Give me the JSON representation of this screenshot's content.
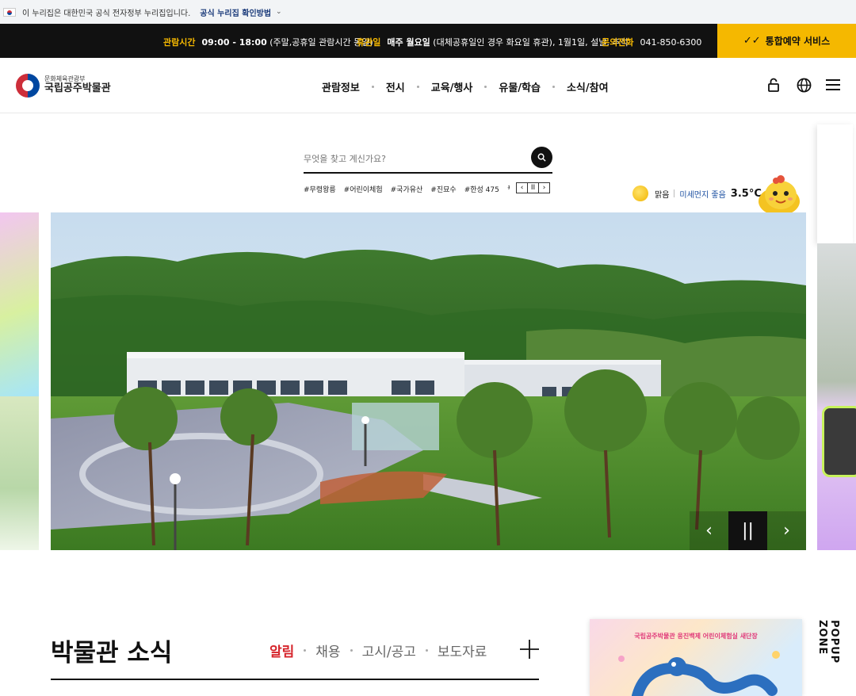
{
  "gov_banner": {
    "text": "이 누리집은 대한민국 공식 전자정부 누리집입니다.",
    "link": "공식 누리집 확인방법"
  },
  "info_bar": {
    "hours_label": "관람시간",
    "hours_value": "09:00 - 18:00",
    "hours_note": " (주말,공휴일 관람시간 동일)",
    "closed_label": "휴관일",
    "closed_value": "매주 월요일",
    "closed_note": " (대체공휴일인 경우 화요일 휴관), 1월1일, 설날, 추석",
    "phone_label": "문의전화",
    "phone_value": "041-850-6300",
    "reserve_label": "통합예약 서비스"
  },
  "header": {
    "logo_small": "문화체육관광부",
    "logo_big": "국립공주박물관",
    "nav": [
      "관람정보",
      "전시",
      "교육/행사",
      "유물/학습",
      "소식/참여"
    ]
  },
  "search": {
    "placeholder": "무엇을 찾고 계신가요?",
    "tags": [
      "#무령왕릉",
      "#어린이체험",
      "#국가유산",
      "#진묘수",
      "#한성 475",
      "#"
    ]
  },
  "weather": {
    "condition": "맑음",
    "dust": "미세먼지 좋음",
    "temperature": "3.5°C"
  },
  "news": {
    "title": "박물관 소식",
    "tabs": [
      "알림",
      "채용",
      "고시/공고",
      "보도자료"
    ]
  },
  "popup": {
    "label": "POPUP ZONE",
    "caption": "국립공주박물관 웅진백제 어린이체험실 새단장"
  },
  "colors": {
    "accent": "#f5b800",
    "dark": "#111111",
    "active_tab": "#d6242b"
  }
}
